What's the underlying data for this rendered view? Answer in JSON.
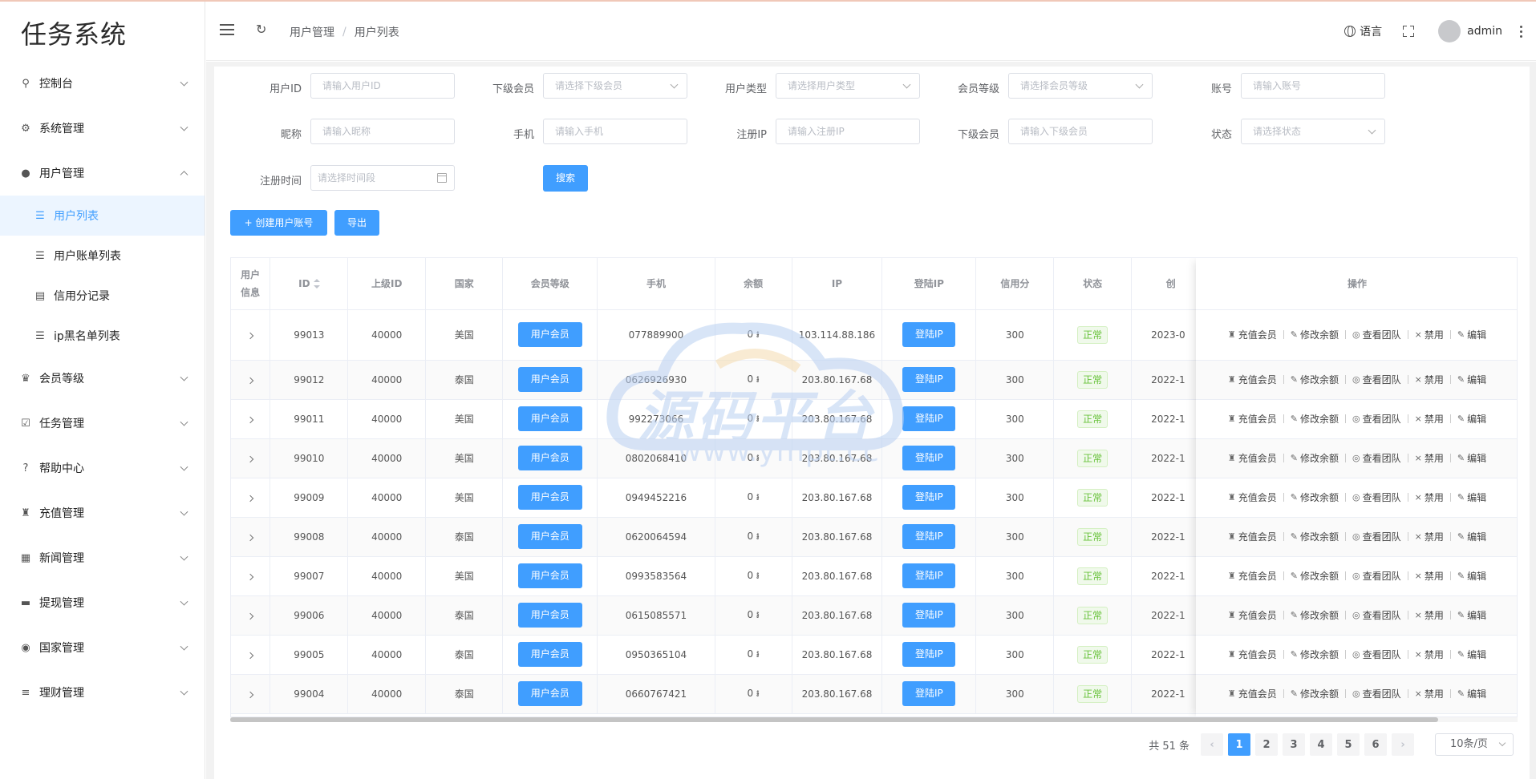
{
  "app": {
    "title": "任务系统"
  },
  "sidebar": {
    "items": [
      {
        "label": "控制台",
        "icon": "dashboard-icon"
      },
      {
        "label": "系统管理",
        "icon": "gear-icon"
      },
      {
        "label": "用户管理",
        "icon": "user-icon",
        "expanded": true,
        "children": [
          {
            "label": "用户列表",
            "icon": "list-icon",
            "active": true
          },
          {
            "label": "用户账单列表",
            "icon": "list-icon"
          },
          {
            "label": "信用分记录",
            "icon": "clipboard-icon"
          },
          {
            "label": "ip黑名单列表",
            "icon": "list-icon"
          }
        ]
      },
      {
        "label": "会员等级",
        "icon": "crown-icon"
      },
      {
        "label": "任务管理",
        "icon": "task-icon"
      },
      {
        "label": "帮助中心",
        "icon": "help-icon"
      },
      {
        "label": "充值管理",
        "icon": "money-bag-icon"
      },
      {
        "label": "新闻管理",
        "icon": "news-icon"
      },
      {
        "label": "提现管理",
        "icon": "wallet-icon"
      },
      {
        "label": "国家管理",
        "icon": "globe-icon"
      },
      {
        "label": "理财管理",
        "icon": "database-icon"
      }
    ]
  },
  "header": {
    "breadcrumb": [
      "用户管理",
      "用户列表"
    ],
    "lang_label": "语言",
    "username": "admin"
  },
  "filters": {
    "user_id": {
      "label": "用户ID",
      "placeholder": "请输入用户ID"
    },
    "sub_member": {
      "label": "下级会员",
      "placeholder": "请选择下级会员"
    },
    "user_type": {
      "label": "用户类型",
      "placeholder": "请选择用户类型"
    },
    "member_level": {
      "label": "会员等级",
      "placeholder": "请选择会员等级"
    },
    "account": {
      "label": "账号",
      "placeholder": "请输入账号"
    },
    "nickname": {
      "label": "昵称",
      "placeholder": "请输入昵称"
    },
    "phone": {
      "label": "手机",
      "placeholder": "请输入手机"
    },
    "reg_ip": {
      "label": "注册IP",
      "placeholder": "请输入注册IP"
    },
    "sub_member2": {
      "label": "下级会员",
      "placeholder": "请输入下级会员"
    },
    "status": {
      "label": "状态",
      "placeholder": "请选择状态"
    },
    "reg_time": {
      "label": "注册时间",
      "placeholder": "请选择时间段"
    },
    "search_label": "搜索"
  },
  "toolbar": {
    "create_label": "+ 创建用户账号",
    "export_label": "导出"
  },
  "table": {
    "headers": {
      "info": "用户信息",
      "id": "ID",
      "parent_id": "上级ID",
      "country": "国家",
      "level": "会员等级",
      "phone": "手机",
      "balance": "余额",
      "ip": "IP",
      "login_ip": "登陆IP",
      "credit": "信用分",
      "status": "状态",
      "created": "创",
      "ops": "操作"
    },
    "rows": [
      {
        "id": "99013",
        "parent_id": "40000",
        "country": "美国",
        "level": "用户会员",
        "phone": "077889900",
        "balance": "0 ៛",
        "ip": "103.114.88.186",
        "login_ip": "登陆IP",
        "credit": "300",
        "status": "正常",
        "created": "2023-0"
      },
      {
        "id": "99012",
        "parent_id": "40000",
        "country": "泰国",
        "level": "用户会员",
        "phone": "0626926930",
        "balance": "0 ៛",
        "ip": "203.80.167.68",
        "login_ip": "登陆IP",
        "credit": "300",
        "status": "正常",
        "created": "2022-1"
      },
      {
        "id": "99011",
        "parent_id": "40000",
        "country": "美国",
        "level": "用户会员",
        "phone": "992273066",
        "balance": "0 ៛",
        "ip": "203.80.167.68",
        "login_ip": "登陆IP",
        "credit": "300",
        "status": "正常",
        "created": "2022-1"
      },
      {
        "id": "99010",
        "parent_id": "40000",
        "country": "美国",
        "level": "用户会员",
        "phone": "0802068410",
        "balance": "0 ៛",
        "ip": "203.80.167.68",
        "login_ip": "登陆IP",
        "credit": "300",
        "status": "正常",
        "created": "2022-1"
      },
      {
        "id": "99009",
        "parent_id": "40000",
        "country": "美国",
        "level": "用户会员",
        "phone": "0949452216",
        "balance": "0 ៛",
        "ip": "203.80.167.68",
        "login_ip": "登陆IP",
        "credit": "300",
        "status": "正常",
        "created": "2022-1"
      },
      {
        "id": "99008",
        "parent_id": "40000",
        "country": "泰国",
        "level": "用户会员",
        "phone": "0620064594",
        "balance": "0 ៛",
        "ip": "203.80.167.68",
        "login_ip": "登陆IP",
        "credit": "300",
        "status": "正常",
        "created": "2022-1"
      },
      {
        "id": "99007",
        "parent_id": "40000",
        "country": "美国",
        "level": "用户会员",
        "phone": "0993583564",
        "balance": "0 ៛",
        "ip": "203.80.167.68",
        "login_ip": "登陆IP",
        "credit": "300",
        "status": "正常",
        "created": "2022-1"
      },
      {
        "id": "99006",
        "parent_id": "40000",
        "country": "泰国",
        "level": "用户会员",
        "phone": "0615085571",
        "balance": "0 ៛",
        "ip": "203.80.167.68",
        "login_ip": "登陆IP",
        "credit": "300",
        "status": "正常",
        "created": "2022-1"
      },
      {
        "id": "99005",
        "parent_id": "40000",
        "country": "泰国",
        "level": "用户会员",
        "phone": "0950365104",
        "balance": "0 ៛",
        "ip": "203.80.167.68",
        "login_ip": "登陆IP",
        "credit": "300",
        "status": "正常",
        "created": "2022-1"
      },
      {
        "id": "99004",
        "parent_id": "40000",
        "country": "泰国",
        "level": "用户会员",
        "phone": "0660767421",
        "balance": "0 ៛",
        "ip": "203.80.167.68",
        "login_ip": "登陆IP",
        "credit": "300",
        "status": "正常",
        "created": "2022-1"
      }
    ],
    "ops": [
      {
        "label": "充值会员",
        "icon": "money-bag-icon"
      },
      {
        "label": "修改余额",
        "icon": "edit-icon"
      },
      {
        "label": "查看团队",
        "icon": "eye-icon"
      },
      {
        "label": "禁用",
        "icon": "close-icon"
      },
      {
        "label": "编辑",
        "icon": "edit-icon"
      }
    ]
  },
  "pagination": {
    "total": "共 51 条",
    "pages": [
      "1",
      "2",
      "3",
      "4",
      "5",
      "6"
    ],
    "current": "1",
    "page_size": "10条/页"
  },
  "watermark": {
    "text": "源码平台",
    "url": "www.ympt.cc"
  },
  "colors": {
    "primary": "#409eff",
    "success": "#67c23a",
    "watermark": "#b9d0f2"
  }
}
